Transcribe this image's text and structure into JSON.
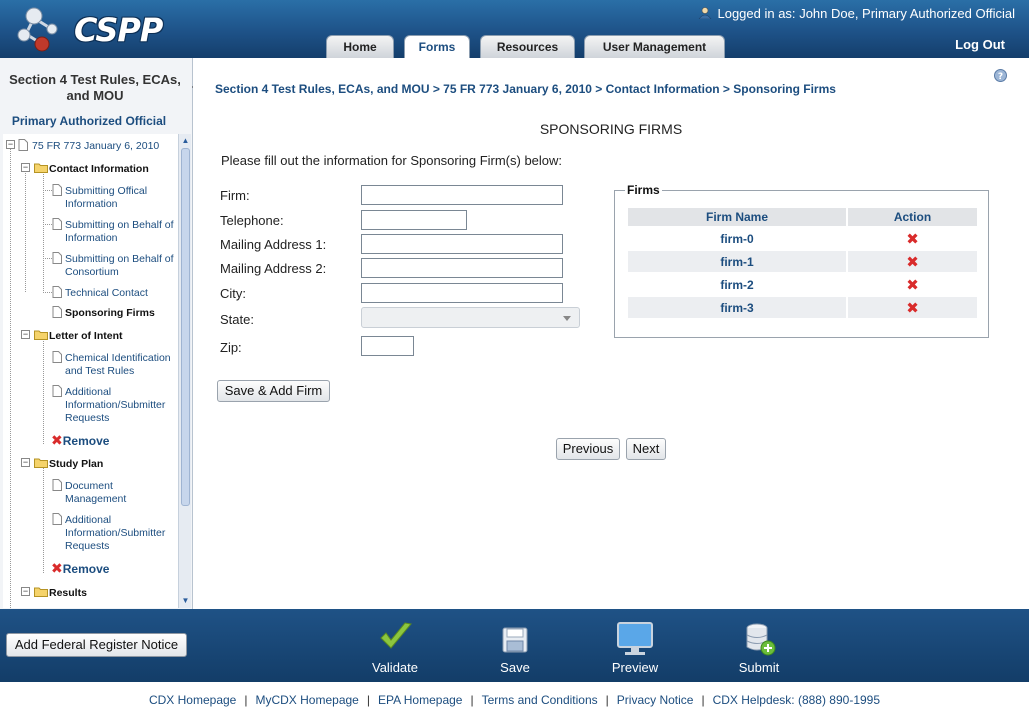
{
  "header": {
    "logo_text": "CSPP",
    "login_prefix": "Logged in as:",
    "login_user": "John Doe, Primary Authorized Official",
    "logout": "Log Out",
    "tabs": [
      {
        "label": "Home"
      },
      {
        "label": "Forms"
      },
      {
        "label": "Resources"
      },
      {
        "label": "User Management"
      }
    ]
  },
  "left_panel": {
    "heading": "Section 4 Test Rules, ECAs, and MOU",
    "role": "Primary Authorized Official",
    "tree": {
      "root": "75 FR 773 January 6, 2010",
      "contact_information": "Contact Information",
      "submitting_official": "Submitting Offical Information",
      "submitting_behalf_information": "Submitting on Behalf of Information",
      "submitting_behalf_consortium": "Submitting on Behalf of Consortium",
      "technical_contact": "Technical Contact",
      "sponsoring_firms": "Sponsoring Firms",
      "letter_of_intent": "Letter of Intent",
      "chemical_identification": "Chemical Identification and Test Rules",
      "additional_info_1": "Additional Information/Submitter Requests",
      "remove_1": "Remove",
      "study_plan": "Study Plan",
      "document_management": "Document Management",
      "additional_info_2": "Additional Information/Submitter Requests",
      "remove_2": "Remove",
      "results": "Results"
    },
    "add_fr_button": "Add Federal Register Notice"
  },
  "main": {
    "breadcrumb": "Section 4 Test Rules, ECAs, and MOU > 75 FR 773 January 6, 2010 > Contact Information > Sponsoring Firms",
    "title": "SPONSORING FIRMS",
    "instructions": "Please fill out the information for Sponsoring Firm(s) below:",
    "form": {
      "firm_label": "Firm:",
      "firm_value": "",
      "telephone_label": "Telephone:",
      "telephone_value": "",
      "address1_label": "Mailing Address 1:",
      "address1_value": "",
      "address2_label": "Mailing Address 2:",
      "address2_value": "",
      "city_label": "City:",
      "city_value": "",
      "state_label": "State:",
      "state_value": "",
      "zip_label": "Zip:",
      "zip_value": "",
      "save_add_button": "Save & Add Firm"
    },
    "firms": {
      "legend": "Firms",
      "col_name": "Firm Name",
      "col_action": "Action",
      "rows": [
        {
          "name": "firm-0"
        },
        {
          "name": "firm-1"
        },
        {
          "name": "firm-2"
        },
        {
          "name": "firm-3"
        }
      ]
    },
    "previous_button": "Previous",
    "next_button": "Next"
  },
  "toolbar": {
    "validate": "Validate",
    "save": "Save",
    "preview": "Preview",
    "submit": "Submit"
  },
  "footer": {
    "links": [
      "CDX Homepage",
      "MyCDX Homepage",
      "EPA Homepage",
      "Terms and Conditions",
      "Privacy Notice",
      "CDX Helpdesk: (888) 890-1995"
    ]
  },
  "colors": {
    "header_blue": "#1e5288",
    "link_blue": "#1c4d7f",
    "remove_red": "#d92b2b",
    "validate_green": "#7ab51d"
  }
}
